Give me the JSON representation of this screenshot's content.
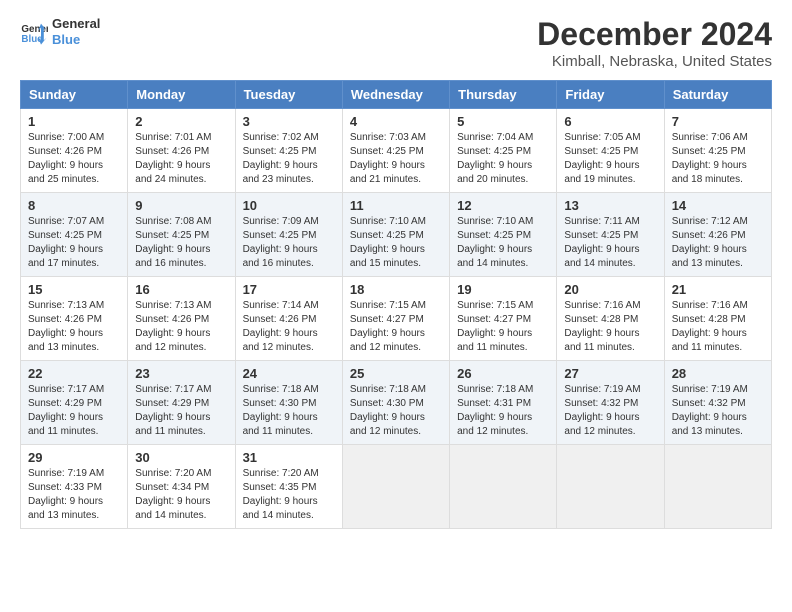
{
  "header": {
    "logo_line1": "General",
    "logo_line2": "Blue",
    "title": "December 2024",
    "subtitle": "Kimball, Nebraska, United States"
  },
  "days_of_week": [
    "Sunday",
    "Monday",
    "Tuesday",
    "Wednesday",
    "Thursday",
    "Friday",
    "Saturday"
  ],
  "weeks": [
    [
      {
        "day": "1",
        "sunrise": "7:00 AM",
        "sunset": "4:26 PM",
        "daylight": "9 hours and 25 minutes."
      },
      {
        "day": "2",
        "sunrise": "7:01 AM",
        "sunset": "4:26 PM",
        "daylight": "9 hours and 24 minutes."
      },
      {
        "day": "3",
        "sunrise": "7:02 AM",
        "sunset": "4:25 PM",
        "daylight": "9 hours and 23 minutes."
      },
      {
        "day": "4",
        "sunrise": "7:03 AM",
        "sunset": "4:25 PM",
        "daylight": "9 hours and 21 minutes."
      },
      {
        "day": "5",
        "sunrise": "7:04 AM",
        "sunset": "4:25 PM",
        "daylight": "9 hours and 20 minutes."
      },
      {
        "day": "6",
        "sunrise": "7:05 AM",
        "sunset": "4:25 PM",
        "daylight": "9 hours and 19 minutes."
      },
      {
        "day": "7",
        "sunrise": "7:06 AM",
        "sunset": "4:25 PM",
        "daylight": "9 hours and 18 minutes."
      }
    ],
    [
      {
        "day": "8",
        "sunrise": "7:07 AM",
        "sunset": "4:25 PM",
        "daylight": "9 hours and 17 minutes."
      },
      {
        "day": "9",
        "sunrise": "7:08 AM",
        "sunset": "4:25 PM",
        "daylight": "9 hours and 16 minutes."
      },
      {
        "day": "10",
        "sunrise": "7:09 AM",
        "sunset": "4:25 PM",
        "daylight": "9 hours and 16 minutes."
      },
      {
        "day": "11",
        "sunrise": "7:10 AM",
        "sunset": "4:25 PM",
        "daylight": "9 hours and 15 minutes."
      },
      {
        "day": "12",
        "sunrise": "7:10 AM",
        "sunset": "4:25 PM",
        "daylight": "9 hours and 14 minutes."
      },
      {
        "day": "13",
        "sunrise": "7:11 AM",
        "sunset": "4:25 PM",
        "daylight": "9 hours and 14 minutes."
      },
      {
        "day": "14",
        "sunrise": "7:12 AM",
        "sunset": "4:26 PM",
        "daylight": "9 hours and 13 minutes."
      }
    ],
    [
      {
        "day": "15",
        "sunrise": "7:13 AM",
        "sunset": "4:26 PM",
        "daylight": "9 hours and 13 minutes."
      },
      {
        "day": "16",
        "sunrise": "7:13 AM",
        "sunset": "4:26 PM",
        "daylight": "9 hours and 12 minutes."
      },
      {
        "day": "17",
        "sunrise": "7:14 AM",
        "sunset": "4:26 PM",
        "daylight": "9 hours and 12 minutes."
      },
      {
        "day": "18",
        "sunrise": "7:15 AM",
        "sunset": "4:27 PM",
        "daylight": "9 hours and 12 minutes."
      },
      {
        "day": "19",
        "sunrise": "7:15 AM",
        "sunset": "4:27 PM",
        "daylight": "9 hours and 11 minutes."
      },
      {
        "day": "20",
        "sunrise": "7:16 AM",
        "sunset": "4:28 PM",
        "daylight": "9 hours and 11 minutes."
      },
      {
        "day": "21",
        "sunrise": "7:16 AM",
        "sunset": "4:28 PM",
        "daylight": "9 hours and 11 minutes."
      }
    ],
    [
      {
        "day": "22",
        "sunrise": "7:17 AM",
        "sunset": "4:29 PM",
        "daylight": "9 hours and 11 minutes."
      },
      {
        "day": "23",
        "sunrise": "7:17 AM",
        "sunset": "4:29 PM",
        "daylight": "9 hours and 11 minutes."
      },
      {
        "day": "24",
        "sunrise": "7:18 AM",
        "sunset": "4:30 PM",
        "daylight": "9 hours and 11 minutes."
      },
      {
        "day": "25",
        "sunrise": "7:18 AM",
        "sunset": "4:30 PM",
        "daylight": "9 hours and 12 minutes."
      },
      {
        "day": "26",
        "sunrise": "7:18 AM",
        "sunset": "4:31 PM",
        "daylight": "9 hours and 12 minutes."
      },
      {
        "day": "27",
        "sunrise": "7:19 AM",
        "sunset": "4:32 PM",
        "daylight": "9 hours and 12 minutes."
      },
      {
        "day": "28",
        "sunrise": "7:19 AM",
        "sunset": "4:32 PM",
        "daylight": "9 hours and 13 minutes."
      }
    ],
    [
      {
        "day": "29",
        "sunrise": "7:19 AM",
        "sunset": "4:33 PM",
        "daylight": "9 hours and 13 minutes."
      },
      {
        "day": "30",
        "sunrise": "7:20 AM",
        "sunset": "4:34 PM",
        "daylight": "9 hours and 14 minutes."
      },
      {
        "day": "31",
        "sunrise": "7:20 AM",
        "sunset": "4:35 PM",
        "daylight": "9 hours and 14 minutes."
      },
      null,
      null,
      null,
      null
    ]
  ],
  "labels": {
    "sunrise": "Sunrise:",
    "sunset": "Sunset:",
    "daylight": "Daylight:"
  }
}
